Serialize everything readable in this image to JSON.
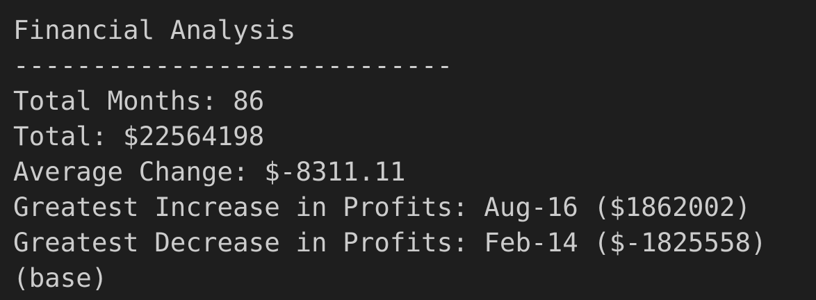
{
  "terminal": {
    "lines": [
      "Financial Analysis",
      "----------------------------",
      "Total Months: 86",
      "Total: $22564198",
      "Average Change: $-8311.11",
      "Greatest Increase in Profits: Aug-16 ($1862002)",
      "Greatest Decrease in Profits: Feb-14 ($-1825558)",
      "(base)"
    ],
    "colors": {
      "background": "#1e1e1e",
      "text": "#cccccc"
    }
  }
}
